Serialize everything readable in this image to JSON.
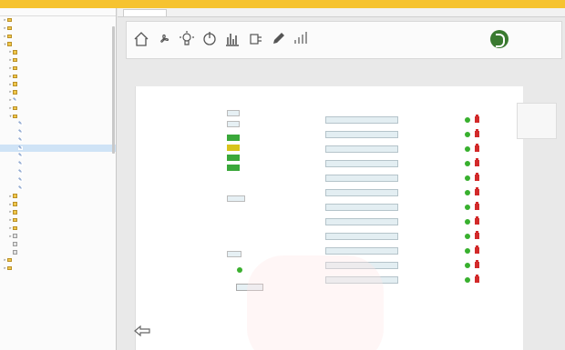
{
  "window": {
    "accent_color": "#f6c330"
  },
  "tree": {
    "search_text": "",
    "close_icon": "close-icon",
    "items": [
      {
        "label": "",
        "depth": 0,
        "icon": "folder",
        "toggle": "▸"
      },
      {
        "label": "",
        "depth": 0,
        "icon": "folder",
        "toggle": "▸"
      },
      {
        "label": "",
        "depth": 0,
        "icon": "folder",
        "toggle": "▸"
      },
      {
        "label": "",
        "depth": 0,
        "icon": "folder",
        "toggle": "▾"
      },
      {
        "label": "",
        "depth": 1,
        "icon": "folder",
        "toggle": "▸"
      },
      {
        "label": "",
        "depth": 1,
        "icon": "folder",
        "toggle": "▸"
      },
      {
        "label": "",
        "depth": 1,
        "icon": "folder",
        "toggle": "▸"
      },
      {
        "label": "",
        "depth": 1,
        "icon": "folder",
        "toggle": "▸"
      },
      {
        "label": "",
        "depth": 1,
        "icon": "folder",
        "toggle": "▸"
      },
      {
        "label": "",
        "depth": 1,
        "icon": "folder",
        "toggle": "▸"
      },
      {
        "label": "",
        "depth": 1,
        "icon": "tool",
        "toggle": "▸"
      },
      {
        "label": "",
        "depth": 1,
        "icon": "folder",
        "toggle": "▸"
      },
      {
        "label": "",
        "depth": 1,
        "icon": "folder",
        "toggle": "▾"
      },
      {
        "label": "",
        "depth": 2,
        "icon": "tool",
        "toggle": ""
      },
      {
        "label": "",
        "depth": 2,
        "icon": "tool",
        "toggle": ""
      },
      {
        "label": "",
        "depth": 2,
        "icon": "tool",
        "toggle": ""
      },
      {
        "label": "",
        "depth": 2,
        "icon": "tool",
        "toggle": "",
        "selected": true
      },
      {
        "label": "",
        "depth": 2,
        "icon": "tool",
        "toggle": ""
      },
      {
        "label": "",
        "depth": 2,
        "icon": "tool",
        "toggle": ""
      },
      {
        "label": "",
        "depth": 2,
        "icon": "tool",
        "toggle": ""
      },
      {
        "label": "",
        "depth": 2,
        "icon": "tool",
        "toggle": ""
      },
      {
        "label": "",
        "depth": 2,
        "icon": "tool",
        "toggle": ""
      },
      {
        "label": "",
        "depth": 1,
        "icon": "folder",
        "toggle": "▸"
      },
      {
        "label": "",
        "depth": 1,
        "icon": "folder",
        "toggle": "▸"
      },
      {
        "label": "",
        "depth": 1,
        "icon": "folder",
        "toggle": "▸"
      },
      {
        "label": "",
        "depth": 1,
        "icon": "folder",
        "toggle": "▸"
      },
      {
        "label": "",
        "depth": 1,
        "icon": "folder",
        "toggle": "▸"
      },
      {
        "label": "",
        "depth": 1,
        "icon": "file",
        "toggle": "▸"
      },
      {
        "label": "",
        "depth": 1,
        "icon": "file",
        "toggle": ""
      },
      {
        "label": "",
        "depth": 1,
        "icon": "file",
        "toggle": ""
      },
      {
        "label": "",
        "depth": 0,
        "icon": "folder",
        "toggle": "▸"
      },
      {
        "label": "",
        "depth": 0,
        "icon": "folder",
        "toggle": "▸"
      }
    ]
  },
  "tab": {
    "label": ""
  },
  "ribbon": {
    "buttons": [
      {
        "name": "home",
        "icon": "house-icon",
        "caption": ""
      },
      {
        "name": "fan",
        "icon": "fan-icon",
        "caption": ""
      },
      {
        "name": "light",
        "icon": "light-bulb-icon",
        "caption": ""
      },
      {
        "name": "power",
        "icon": "power-icon",
        "caption": ""
      },
      {
        "name": "chart",
        "icon": "bar-chart-icon",
        "caption": ""
      },
      {
        "name": "plug",
        "icon": "plug-icon",
        "caption": ""
      },
      {
        "name": "tool",
        "icon": "pencil-icon",
        "caption": ""
      },
      {
        "name": "signal",
        "icon": "signal-icon",
        "caption": ""
      }
    ],
    "info": [
      "",
      "",
      "",
      ""
    ]
  },
  "logo": {
    "line1": "",
    "line2": ""
  },
  "subtitle": "",
  "left_section": {
    "title": "",
    "rows": [
      {
        "label": "",
        "value": ""
      },
      {
        "label": "",
        "value": ""
      }
    ],
    "swatches": [
      {
        "label": "",
        "color": "#3aa83a",
        "suffix": ""
      },
      {
        "label": "",
        "color": "#d8c41c",
        "suffix": ""
      },
      {
        "label": "",
        "color": "#3aa83a",
        "suffix": ""
      },
      {
        "label": "",
        "color": "#3aa83a",
        "suffix": ""
      }
    ],
    "setpoint": {
      "label": "",
      "value": ""
    },
    "mode": {
      "label": "",
      "value": ""
    },
    "unit": {
      "label": "",
      "value": ""
    },
    "status": {
      "label": "",
      "value": ""
    },
    "command": {
      "label": "",
      "button": ""
    },
    "footer": {
      "key": "",
      "label": "",
      "value": ""
    }
  },
  "table": {
    "col_title": "",
    "col_consumo": "",
    "col_estado": "",
    "rows": [
      {
        "label": "",
        "value": ""
      },
      {
        "label": "",
        "value": ""
      },
      {
        "label": "",
        "value": ""
      },
      {
        "label": "",
        "value": ""
      },
      {
        "label": "",
        "value": ""
      },
      {
        "label": "",
        "value": ""
      },
      {
        "label": "",
        "value": ""
      },
      {
        "label": "",
        "value": ""
      },
      {
        "label": "",
        "value": ""
      },
      {
        "label": "",
        "value": ""
      },
      {
        "label": "",
        "value": ""
      },
      {
        "label": "",
        "value": ""
      }
    ]
  },
  "side_note": {
    "text": ""
  },
  "back": {
    "icon": "back-arrow-icon"
  }
}
